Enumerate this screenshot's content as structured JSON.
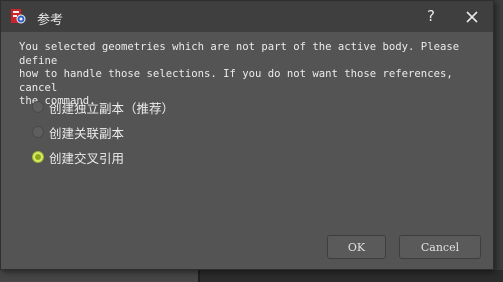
{
  "window": {
    "title": "参考",
    "help_label": "?",
    "icon": "freecad-app-icon",
    "close_icon": "close-icon"
  },
  "message": "You selected geometries which are not part of the active body. Please define\nhow to handle those selections. If you do not want those references, cancel\nthe command.",
  "options": [
    {
      "label": "创建独立副本（推荐）",
      "checked": false
    },
    {
      "label": "创建关联副本",
      "checked": false
    },
    {
      "label": "创建交叉引用",
      "checked": true
    }
  ],
  "buttons": {
    "ok_label": "OK",
    "cancel_label": "Cancel"
  },
  "colors": {
    "dialog_bg": "#545454",
    "titlebar_bg": "#3f3f3f",
    "radio_checked": "#d8e86a"
  }
}
